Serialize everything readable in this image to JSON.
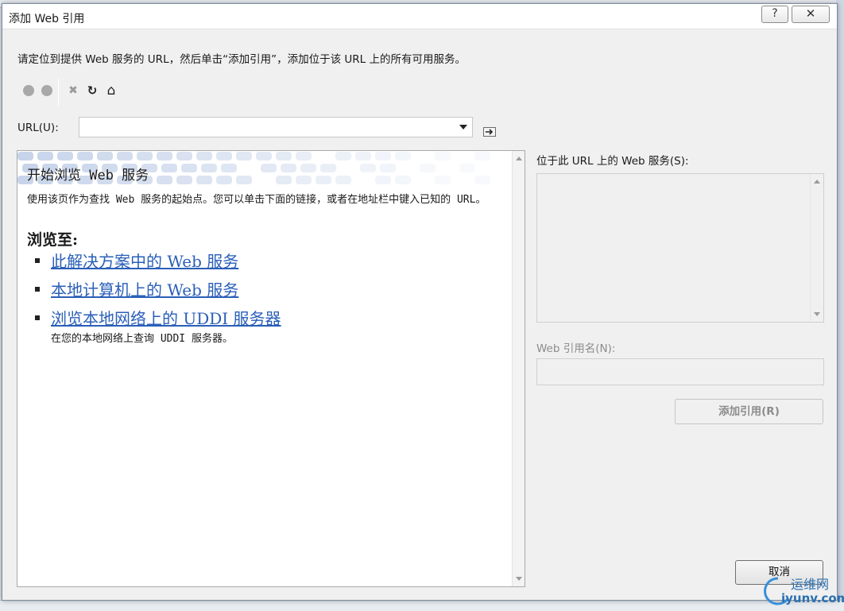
{
  "window": {
    "title": "添加 Web 引用",
    "help_glyph": "?",
    "close_glyph": "✕"
  },
  "instructions": "请定位到提供 Web 服务的 URL，然后单击“添加引用”，添加位于该 URL 上的所有可用服务。",
  "toolbar": {
    "items": [
      {
        "icon": "back-icon"
      },
      {
        "icon": "forward-icon"
      },
      {
        "icon": "stop-icon",
        "glyph": "✖"
      },
      {
        "icon": "refresh-icon",
        "glyph": "↻"
      },
      {
        "icon": "home-icon",
        "glyph": "⌂"
      }
    ]
  },
  "url": {
    "label": "URL(U):",
    "value": "",
    "placeholder": ""
  },
  "browser": {
    "title": "开始浏览 Web 服务",
    "intro": "使用该页作为查找 Web 服务的起始点。您可以单击下面的链接，或者在地址栏中键入已知的 URL。",
    "browse_heading": "浏览至:",
    "links": [
      {
        "label": "此解决方案中的 Web 服务",
        "description": ""
      },
      {
        "label": "本地计算机上的 Web 服务",
        "description": ""
      },
      {
        "label": "浏览本地网络上的 UDDI 服务器",
        "description": "在您的本地网络上查询 UDDI 服务器。"
      }
    ]
  },
  "services": {
    "label": "位于此 URL 上的 Web 服务(S):",
    "items": []
  },
  "reference_name": {
    "label": "Web 引用名(N):",
    "value": ""
  },
  "buttons": {
    "add_reference": "添加引用(R)",
    "cancel": "取消"
  },
  "watermark": {
    "line1": "运维网",
    "line2": "iyunv.com"
  },
  "colors": {
    "link": "#2a5fb8",
    "banner_tile": "#c7d4ea",
    "disabled_text": "#8c8c8c"
  }
}
